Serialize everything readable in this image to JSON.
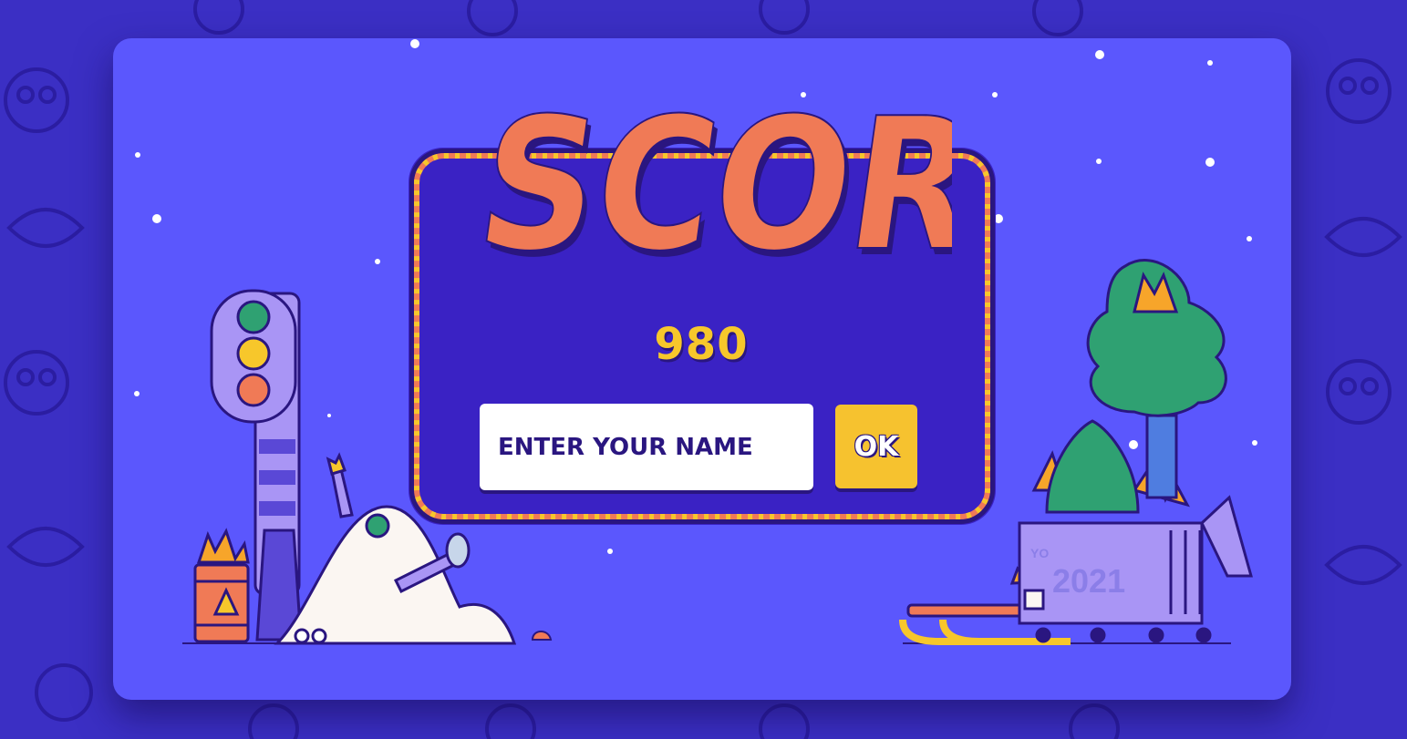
{
  "game": {
    "title": "SCORE",
    "score": "980",
    "name_input": {
      "placeholder": "ENTER YOUR NAME",
      "value": ""
    },
    "ok_label": "OK",
    "dumpster_graffiti": "2021",
    "dumpster_tag": "YO"
  },
  "colors": {
    "background": "#3b2fc4",
    "card": "#5b57fd",
    "panel": "#3a22c4",
    "title": "#f07a56",
    "score": "#f7c72b",
    "ok_button": "#f6c22f"
  }
}
